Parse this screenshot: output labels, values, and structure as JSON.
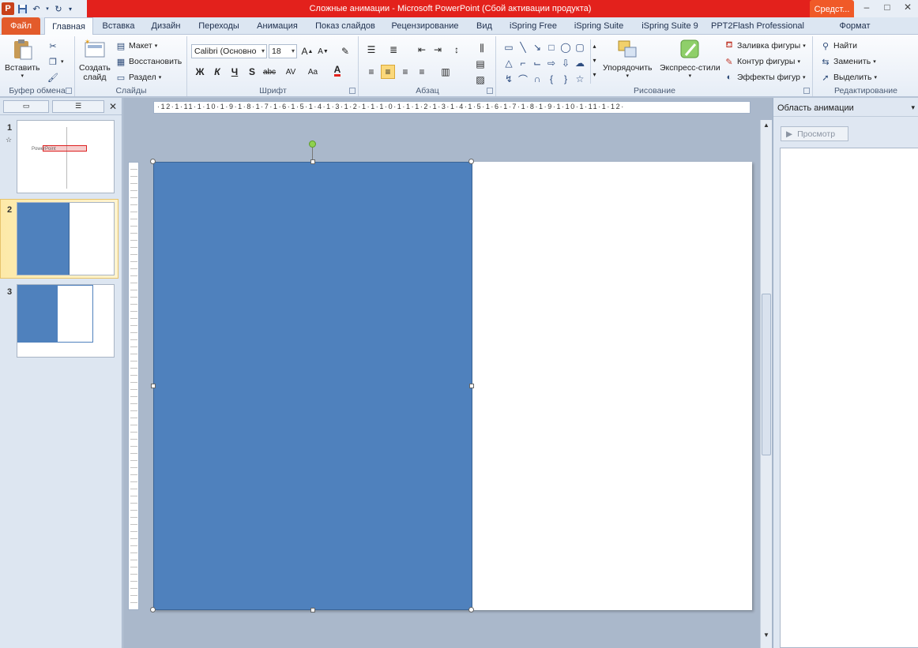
{
  "window": {
    "title": "Сложные анимации  -  Microsoft PowerPoint (Сбой активации продукта)",
    "context_tab_label": "Средст...",
    "controls": {
      "minimize": "–",
      "maximize": "□",
      "close": "✕"
    }
  },
  "quick_access": {
    "app_icon": "P"
  },
  "tabs": [
    {
      "label": "Файл"
    },
    {
      "label": "Главная"
    },
    {
      "label": "Вставка"
    },
    {
      "label": "Дизайн"
    },
    {
      "label": "Переходы"
    },
    {
      "label": "Анимация"
    },
    {
      "label": "Показ слайдов"
    },
    {
      "label": "Рецензирование"
    },
    {
      "label": "Вид"
    },
    {
      "label": "iSpring Free"
    },
    {
      "label": "iSpring Suite"
    },
    {
      "label": "iSpring Suite 9"
    },
    {
      "label": "PPT2Flash Professional"
    },
    {
      "label": "Формат"
    }
  ],
  "ribbon": {
    "clipboard": {
      "label": "Буфер обмена",
      "paste": "Вставить"
    },
    "slides": {
      "label": "Слайды",
      "new_slide_line1": "Создать",
      "new_slide_line2": "слайд",
      "layout": "Макет",
      "reset": "Восстановить",
      "section": "Раздел"
    },
    "font": {
      "label": "Шрифт",
      "font_name": "Calibri (Основно",
      "font_size": "18",
      "bold": "Ж",
      "italic": "К",
      "underline": "Ч",
      "shadow": "S",
      "strike": "abc",
      "spacing": "AV",
      "case": "Aa"
    },
    "paragraph": {
      "label": "Абзац"
    },
    "drawing": {
      "label": "Рисование",
      "arrange": "Упорядочить",
      "quick_styles": "Экспресс-стили",
      "fill": "Заливка фигуры",
      "outline": "Контур фигуры",
      "effects": "Эффекты фигур"
    },
    "editing": {
      "label": "Редактирование",
      "find": "Найти",
      "replace": "Заменить",
      "select": "Выделить"
    }
  },
  "thumbnails": [
    {
      "number": "1",
      "star": "☆",
      "caption": "PowerPoint"
    },
    {
      "number": "2"
    },
    {
      "number": "3"
    }
  ],
  "ruler": {
    "horizontal": "·12·1·11·1·10·1·9·1·8·1·7·1·6·1·5·1·4·1·3·1·2·1·1·1·0·1·1·1·2·1·3·1·4·1·5·1·6·1·7·1·8·1·9·1·10·1·11·1·12·"
  },
  "animation_pane": {
    "title": "Область анимации",
    "preview_button": "Просмотр"
  },
  "colors": {
    "shape_fill": "#4f81bd",
    "title_bar_red": "#e3211c",
    "file_tab": "#e35b2b"
  }
}
